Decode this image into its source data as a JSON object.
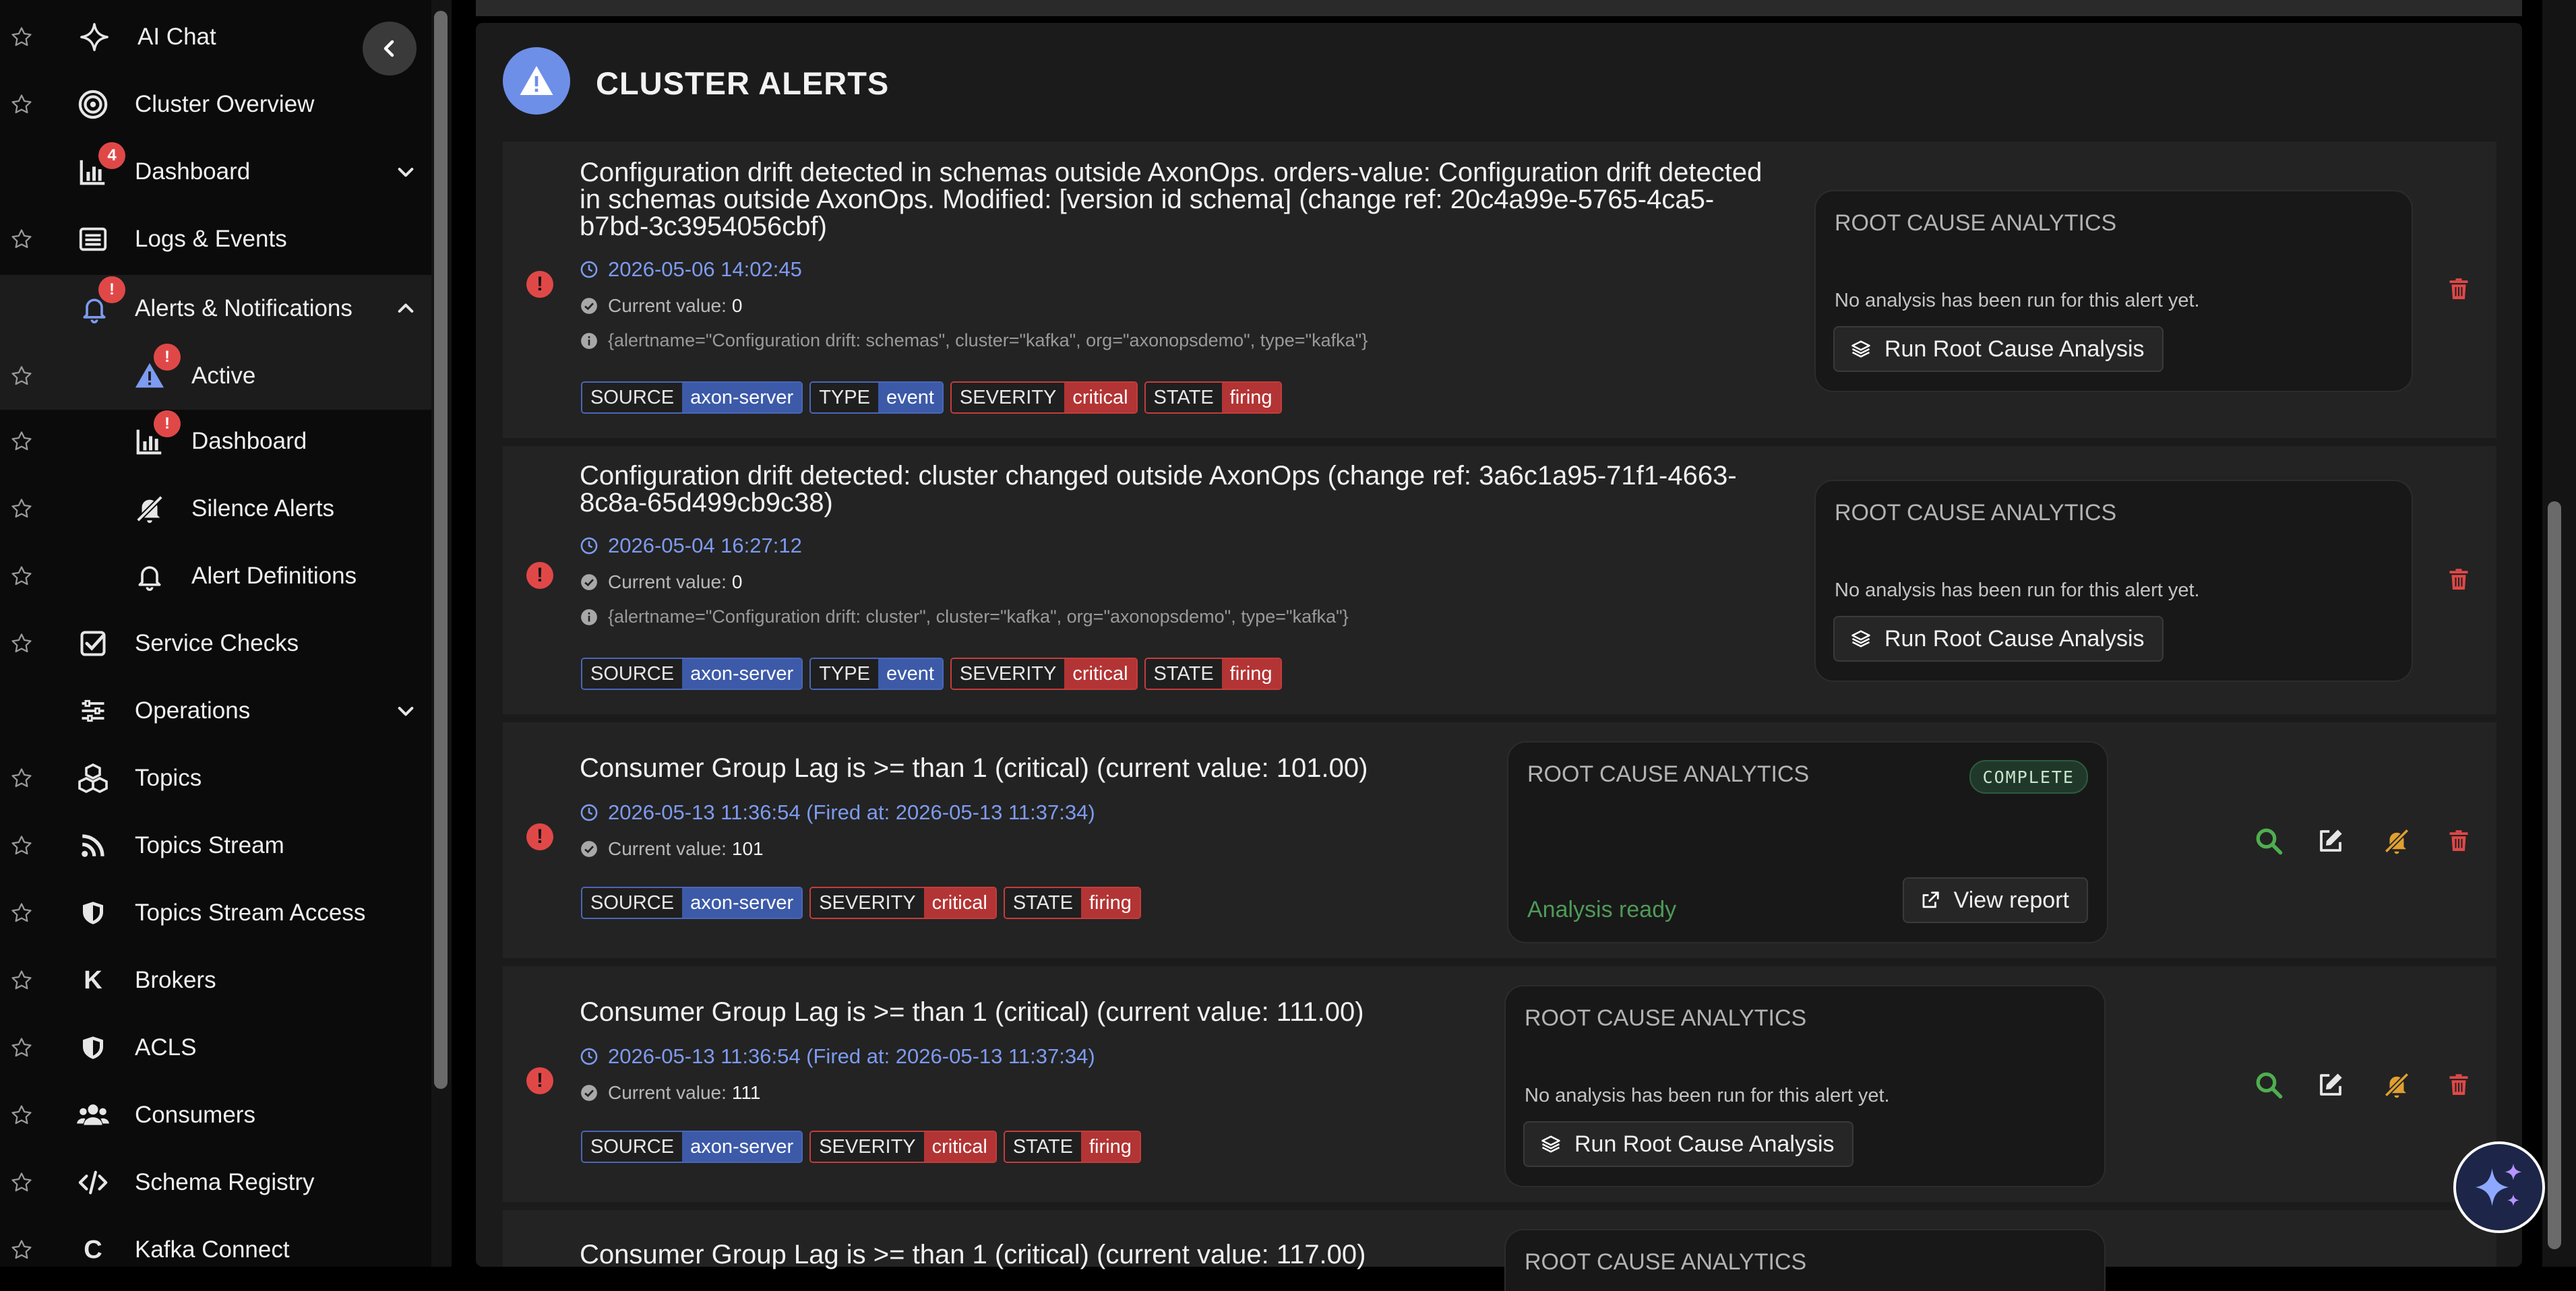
{
  "sidebar": {
    "items": [
      {
        "label": "AI Chat",
        "icon": "sparkle-icon"
      },
      {
        "label": "Cluster Overview",
        "icon": "target-icon"
      },
      {
        "label": "Dashboard",
        "icon": "chart-icon",
        "badge": "4",
        "chevron": "down"
      },
      {
        "label": "Logs & Events",
        "icon": "list-icon"
      },
      {
        "label": "Alerts & Notifications",
        "icon": "bell-icon",
        "badge": "!",
        "chevron": "up"
      },
      {
        "label": "Active",
        "icon": "warning-icon",
        "badge": "!"
      },
      {
        "label": "Dashboard",
        "icon": "chart-icon",
        "badge": "!"
      },
      {
        "label": "Silence Alerts",
        "icon": "bell-slash-icon"
      },
      {
        "label": "Alert Definitions",
        "icon": "bell-icon"
      },
      {
        "label": "Service Checks",
        "icon": "checkbox-icon"
      },
      {
        "label": "Operations",
        "icon": "sliders-icon",
        "chevron": "down"
      },
      {
        "label": "Topics",
        "icon": "cubes-icon"
      },
      {
        "label": "Topics Stream",
        "icon": "rss-icon"
      },
      {
        "label": "Topics Stream Access",
        "icon": "shield-icon"
      },
      {
        "label": "Brokers",
        "icon": "k-icon",
        "glyph": "K"
      },
      {
        "label": "ACLS",
        "icon": "shield-icon"
      },
      {
        "label": "Consumers",
        "icon": "users-icon"
      },
      {
        "label": "Schema Registry",
        "icon": "code-icon"
      },
      {
        "label": "Kafka Connect",
        "icon": "c-icon",
        "glyph": "C"
      }
    ]
  },
  "panel": {
    "title": "CLUSTER ALERTS"
  },
  "alerts": [
    {
      "title": "Configuration drift detected in schemas outside AxonOps. orders-value: Configuration drift detected in schemas outside AxonOps. Modified: [version id schema] (change ref: 20c4a99e-5765-4ca5-b7bd-3c3954056cbf)",
      "date": "2026-05-06 14:02:45",
      "current_label": "Current value:",
      "current_value": "0",
      "labels": "{alertname=\"Configuration drift: schemas\", cluster=\"kafka\", org=\"axonopsdemo\", type=\"kafka\"}",
      "tags": [
        {
          "key": "SOURCE",
          "value": "axon-server",
          "color": "blue"
        },
        {
          "key": "TYPE",
          "value": "event",
          "color": "blue"
        },
        {
          "key": "SEVERITY",
          "value": "critical",
          "color": "red"
        },
        {
          "key": "STATE",
          "value": "firing",
          "color": "red"
        }
      ],
      "rca": {
        "title": "ROOT CAUSE ANALYTICS",
        "message": "No analysis has been run for this alert yet.",
        "button": "Run Root Cause Analysis"
      }
    },
    {
      "title": "Configuration drift detected: cluster changed outside AxonOps (change ref: 3a6c1a95-71f1-4663-8c8a-65d499cb9c38)",
      "date": "2026-05-04 16:27:12",
      "current_label": "Current value:",
      "current_value": "0",
      "labels": "{alertname=\"Configuration drift: cluster\", cluster=\"kafka\", org=\"axonopsdemo\", type=\"kafka\"}",
      "tags": [
        {
          "key": "SOURCE",
          "value": "axon-server",
          "color": "blue"
        },
        {
          "key": "TYPE",
          "value": "event",
          "color": "blue"
        },
        {
          "key": "SEVERITY",
          "value": "critical",
          "color": "red"
        },
        {
          "key": "STATE",
          "value": "firing",
          "color": "red"
        }
      ],
      "rca": {
        "title": "ROOT CAUSE ANALYTICS",
        "message": "No analysis has been run for this alert yet.",
        "button": "Run Root Cause Analysis"
      }
    },
    {
      "title": "Consumer Group Lag is >= than 1 (critical) (current value: 101.00)",
      "date": "2026-05-13 11:36:54 (Fired at: 2026-05-13 11:37:34)",
      "current_label": "Current value:",
      "current_value": "101",
      "tags": [
        {
          "key": "SOURCE",
          "value": "axon-server",
          "color": "blue"
        },
        {
          "key": "SEVERITY",
          "value": "critical",
          "color": "red"
        },
        {
          "key": "STATE",
          "value": "firing",
          "color": "red"
        }
      ],
      "rca": {
        "title": "ROOT CAUSE ANALYTICS",
        "status": "COMPLETE",
        "ready": "Analysis ready",
        "button": "View report"
      }
    },
    {
      "title": "Consumer Group Lag is >= than 1 (critical) (current value: 111.00)",
      "date": "2026-05-13 11:36:54 (Fired at: 2026-05-13 11:37:34)",
      "current_label": "Current value:",
      "current_value": "111",
      "tags": [
        {
          "key": "SOURCE",
          "value": "axon-server",
          "color": "blue"
        },
        {
          "key": "SEVERITY",
          "value": "critical",
          "color": "red"
        },
        {
          "key": "STATE",
          "value": "firing",
          "color": "red"
        }
      ],
      "rca": {
        "title": "ROOT CAUSE ANALYTICS",
        "message": "No analysis has been run for this alert yet.",
        "button": "Run Root Cause Analysis"
      }
    },
    {
      "title": "Consumer Group Lag is >= than 1 (critical) (current value: 117.00)",
      "rca": {
        "title": "ROOT CAUSE ANALYTICS"
      }
    }
  ],
  "colors": {
    "accent_blue": "#6e8fe8",
    "critical_red": "#e04848",
    "success_green": "#4f9a58",
    "action_orange": "#e0a030"
  }
}
